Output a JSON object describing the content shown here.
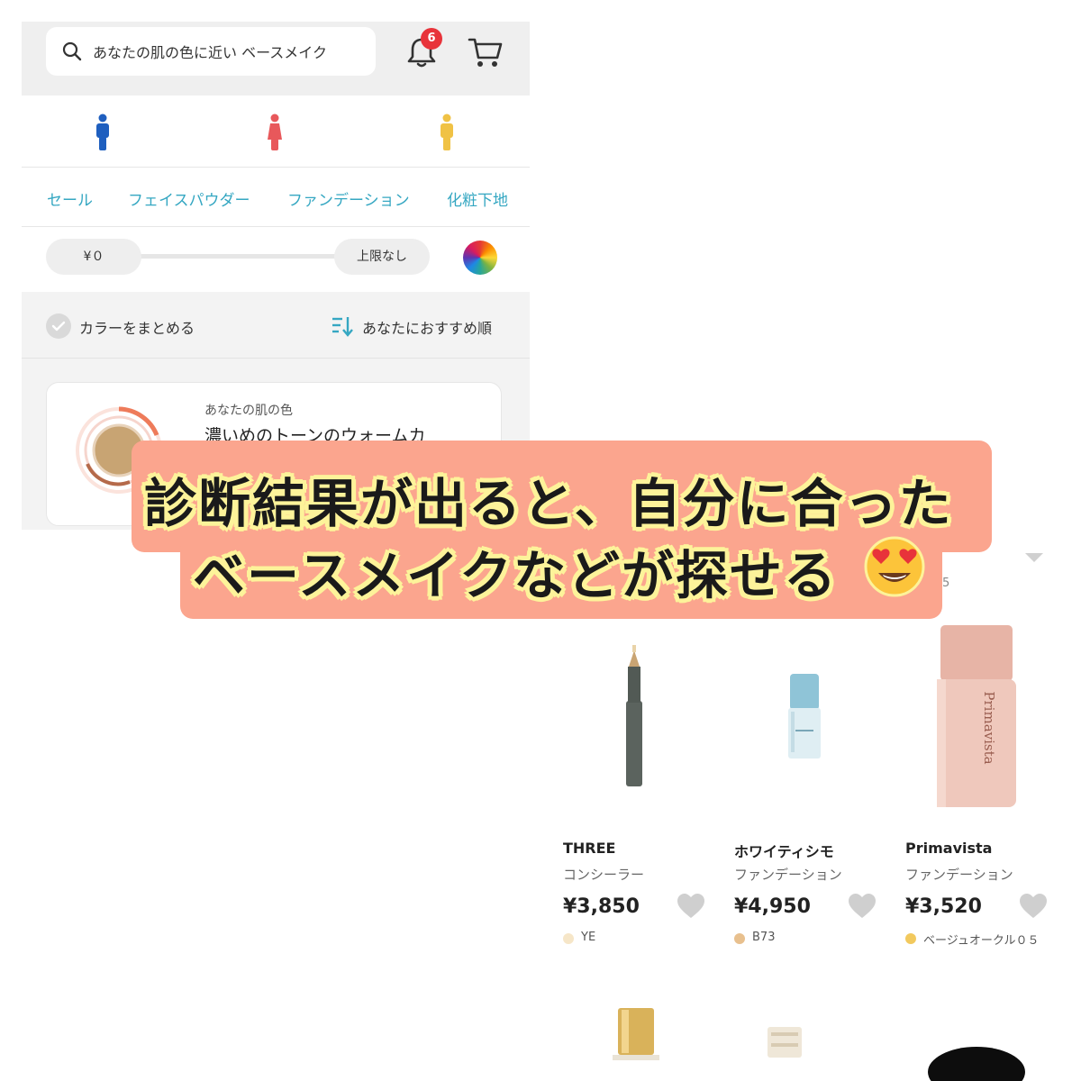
{
  "header": {
    "search_text": "あなたの肌の色に近い ベースメイク",
    "notification_count": "6"
  },
  "categories": [
    "セール",
    "フェイスパウダー",
    "ファンデーション",
    "化粧下地"
  ],
  "price_filter": {
    "min": "¥０",
    "max": "上限なし"
  },
  "filter": {
    "group_colors": "カラーをまとめる",
    "sort": "あなたにおすすめ順"
  },
  "skin": {
    "label": "あなたの肌の色",
    "tone": "濃いめのトーンのウォームカ"
  },
  "peek": {
    "text": "5"
  },
  "products": [
    {
      "brand": "THREE",
      "category": "コンシーラー",
      "price": "¥3,850",
      "color_name": "YE",
      "color": "#f6e6c8"
    },
    {
      "brand": "ホワイティシモ",
      "category": "ファンデーション",
      "price": "¥4,950",
      "color_name": "B73",
      "color": "#e8c08e"
    },
    {
      "brand": "Primavista",
      "category": "ファンデーション",
      "price": "¥3,520",
      "color_name": "ベージュオークル０５",
      "color": "#f2c95e"
    }
  ],
  "caption": {
    "line1": "診断結果が出ると、自分に合った",
    "line2": "ベースメイクなどが探せる",
    "emoji": "heart-eyes-emoji"
  },
  "colors": {
    "accent": "#35a7c2",
    "badge": "#e8333a",
    "caption_bg": "#fba58e",
    "caption_outline": "#fdf39a"
  }
}
